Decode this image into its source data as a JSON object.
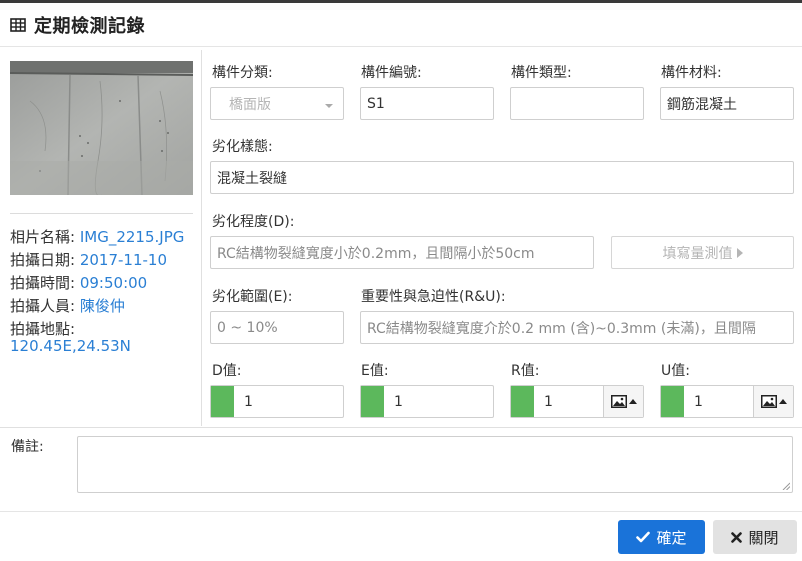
{
  "window": {
    "title": "定期檢測記錄"
  },
  "photo_info": {
    "name_label": "相片名稱:",
    "name": "IMG_2215.JPG",
    "date_label": "拍攝日期:",
    "date": "2017-11-10",
    "time_label": "拍攝時間:",
    "time": "09:50:00",
    "person_label": "拍攝人員:",
    "person": "陳俊仲",
    "location_label": "拍攝地點:",
    "location": "120.45E,24.53N"
  },
  "form": {
    "component_category": {
      "label": "構件分類:",
      "value": "橋面版"
    },
    "component_id": {
      "label": "構件編號:",
      "value": "S1"
    },
    "component_type": {
      "label": "構件類型:",
      "value": ""
    },
    "component_material": {
      "label": "構件材料:",
      "value": "鋼筋混凝土"
    },
    "deterioration_pattern": {
      "label": "劣化樣態:",
      "value": "混凝土裂縫"
    },
    "deterioration_degree": {
      "label": "劣化程度(D):",
      "value": "RC結構物裂縫寬度小於0.2mm，且間隔小於50cm"
    },
    "fill_measure_button": "填寫量測值",
    "deterioration_range": {
      "label": "劣化範圍(E):",
      "value": "0 ~ 10%"
    },
    "importance_urgency": {
      "label": "重要性與急迫性(R&U):",
      "value": "RC結構物裂縫寬度介於0.2 mm (含)~0.3mm (未滿)，且間隔"
    },
    "scores": [
      {
        "label": "D值:",
        "value": "1",
        "color": "#5cb85c"
      },
      {
        "label": "E值:",
        "value": "1",
        "color": "#5cb85c"
      },
      {
        "label": "R值:",
        "value": "1",
        "color": "#5cb85c"
      },
      {
        "label": "U值:",
        "value": "1",
        "color": "#5cb85c"
      }
    ],
    "remarks": {
      "label": "備註:",
      "value": ""
    }
  },
  "footer": {
    "confirm_label": "確定",
    "close_label": "關閉"
  },
  "icons": [
    "table-grid-icon",
    "image-icon",
    "caret-up-icon",
    "checkmark-icon",
    "close-x-icon",
    "chevron-right-icon"
  ],
  "colors": {
    "primary": "#1a73d9",
    "score_green": "#5cb85c",
    "link_blue": "#2a7fd4"
  }
}
